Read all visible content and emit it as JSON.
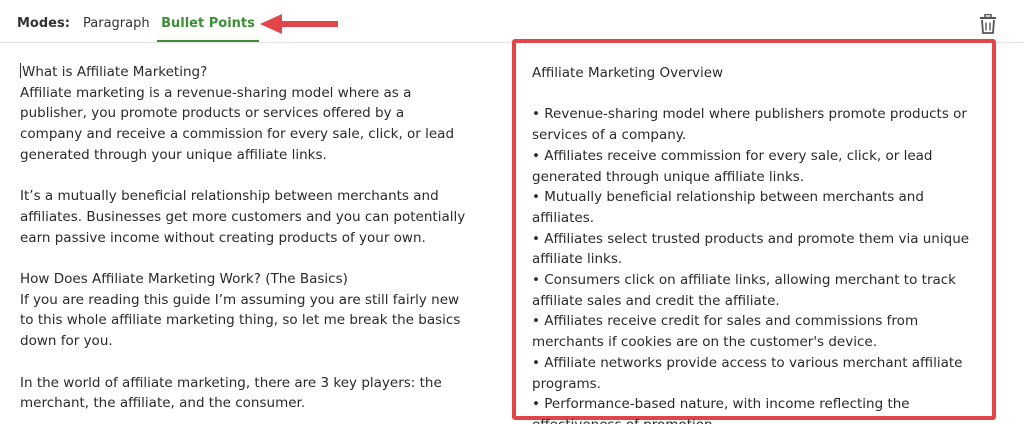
{
  "toolbar": {
    "modes_label": "Modes:",
    "tabs": [
      {
        "label": "Paragraph",
        "active": false
      },
      {
        "label": "Bullet Points",
        "active": true
      }
    ],
    "active_color": "#3e8e37",
    "delete_icon": "trash-icon"
  },
  "annotation": {
    "arrow_color": "#e0454a",
    "box_color": "#e0454a"
  },
  "source_text": {
    "paragraphs": [
      "What is Affiliate Marketing?\nAffiliate marketing is a revenue-sharing model where as a publisher, you promote products or services offered by a company and receive a commission for every sale, click, or lead generated through your unique affiliate links.",
      "It’s a mutually beneficial relationship between merchants and affiliates. Businesses get more customers and you can potentially earn passive income without creating products of your own.",
      "How Does Affiliate Marketing Work? (The Basics)\nIf you are reading this guide I’m assuming you are still fairly new to this whole affiliate marketing thing, so let me break the basics down for you.",
      "In the world of affiliate marketing, there are 3 key players: the merchant, the affiliate, and the consumer."
    ]
  },
  "output": {
    "title": "Affiliate Marketing Overview",
    "bullets": [
      "• Revenue-sharing model where publishers promote products or services of a company.",
      "• Affiliates receive commission for every sale, click, or lead generated through unique affiliate links.",
      "• Mutually beneficial relationship between merchants and affiliates.",
      "• Affiliates select trusted products and promote them via unique affiliate links.",
      "• Consumers click on affiliate links, allowing merchant to track affiliate sales and credit the affiliate.",
      "• Affiliates receive credit for sales and commissions from merchants if cookies are on the customer's device.",
      "• Affiliate networks provide access to various merchant affiliate programs.",
      "• Performance-based nature, with income reflecting the effectiveness of promotion."
    ]
  }
}
